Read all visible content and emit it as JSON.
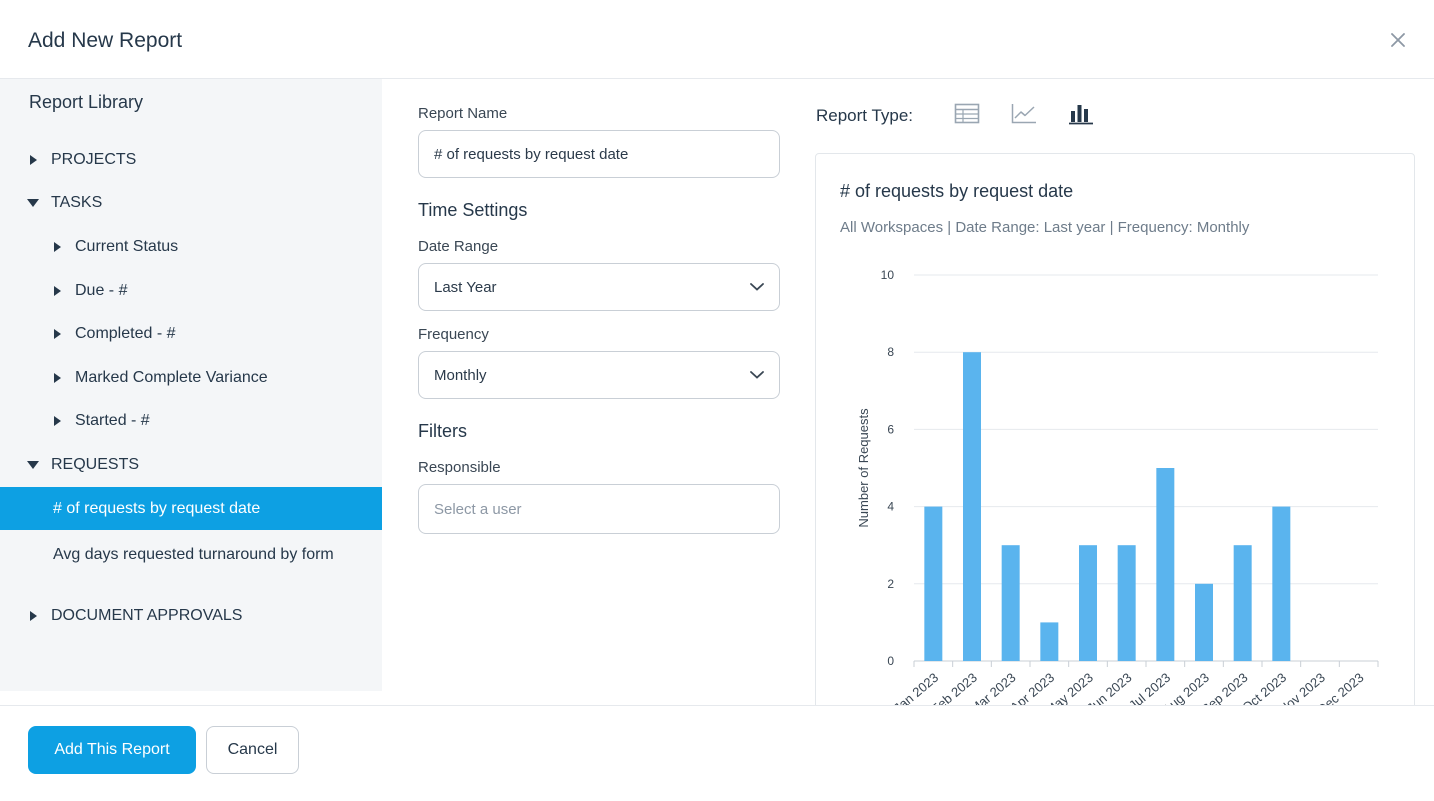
{
  "dialog": {
    "title": "Add New Report",
    "close_icon": "close-icon"
  },
  "library": {
    "title": "Report Library",
    "items": [
      {
        "label": "PROJECTS",
        "level": 0,
        "state": "collapsed"
      },
      {
        "label": "TASKS",
        "level": 0,
        "state": "expanded"
      },
      {
        "label": "Current Status",
        "level": 1,
        "state": "collapsed"
      },
      {
        "label": "Due - #",
        "level": 1,
        "state": "collapsed"
      },
      {
        "label": "Completed - #",
        "level": 1,
        "state": "collapsed"
      },
      {
        "label": "Marked Complete Variance",
        "level": 1,
        "state": "collapsed"
      },
      {
        "label": "Started - #",
        "level": 1,
        "state": "collapsed"
      },
      {
        "label": "REQUESTS",
        "level": 0,
        "state": "expanded"
      },
      {
        "label": "# of requests by request date",
        "level": 1,
        "state": "selected"
      },
      {
        "label": "Avg days requested turnaround by form",
        "level": 1,
        "state": "leaf"
      },
      {
        "label": "DOCUMENT APPROVALS",
        "level": 0,
        "state": "collapsed"
      }
    ]
  },
  "form": {
    "report_name_label": "Report Name",
    "report_name_value": "# of requests by request date",
    "time_settings_heading": "Time Settings",
    "date_range_label": "Date Range",
    "date_range_value": "Last Year",
    "frequency_label": "Frequency",
    "frequency_value": "Monthly",
    "filters_heading": "Filters",
    "responsible_label": "Responsible",
    "responsible_placeholder": "Select a user"
  },
  "report_type": {
    "label": "Report Type:",
    "options": [
      "table-icon",
      "line-chart-icon",
      "bar-chart-icon"
    ],
    "selected": "bar-chart-icon"
  },
  "chart_data": {
    "type": "bar",
    "title": "# of requests by request date",
    "subtitle": "All Workspaces | Date Range: Last year | Frequency: Monthly",
    "ylabel": "Number of Requests",
    "xlabel": "",
    "categories": [
      "Jan 2023",
      "Feb 2023",
      "Mar 2023",
      "Apr 2023",
      "May 2023",
      "Jun 2023",
      "Jul 2023",
      "Aug 2023",
      "Sep 2023",
      "Oct 2023",
      "Nov 2023",
      "Dec 2023"
    ],
    "values": [
      4,
      8,
      3,
      1,
      3,
      3,
      5,
      2,
      3,
      4,
      0,
      0
    ],
    "ylim": [
      0,
      10
    ],
    "yticks": [
      0,
      2,
      4,
      6,
      8,
      10
    ],
    "grid": true,
    "bar_color": "#5ab4ee"
  },
  "footer": {
    "primary_label": "Add This Report",
    "secondary_label": "Cancel"
  },
  "colors": {
    "accent": "#0da0e3",
    "sidebar_bg": "#f4f6f8",
    "text": "#26384a"
  }
}
